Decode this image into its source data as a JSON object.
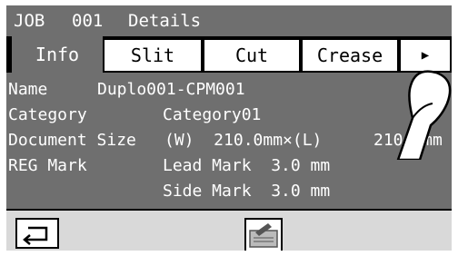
{
  "header": {
    "title_job": "JOB",
    "title_number": "001",
    "title_details": "Details"
  },
  "tabs": [
    {
      "label": "Info",
      "active": true
    },
    {
      "label": "Slit",
      "active": false
    },
    {
      "label": "Cut",
      "active": false
    },
    {
      "label": "Crease",
      "active": false
    },
    {
      "label": "▶",
      "active": false
    }
  ],
  "details": {
    "name_label": "Name",
    "name_value": "Duplo001-CPM001",
    "category_label": "Category",
    "category_value": "Category01",
    "doc_size_label": "Document Size",
    "doc_size_w": "(W)  210.0mm×(L)",
    "doc_size_l": "210.0mm",
    "reg_mark_label": "REG Mark",
    "lead_mark": "Lead Mark  3.0 mm",
    "side_mark": "Side Mark  3.0 mm"
  },
  "footer": {
    "back_icon": "back-arrow-icon",
    "edit_icon": "edit-document-icon"
  },
  "colors": {
    "panel_gray": "#6f6f6f",
    "footer_gray": "#d9d9d9"
  }
}
